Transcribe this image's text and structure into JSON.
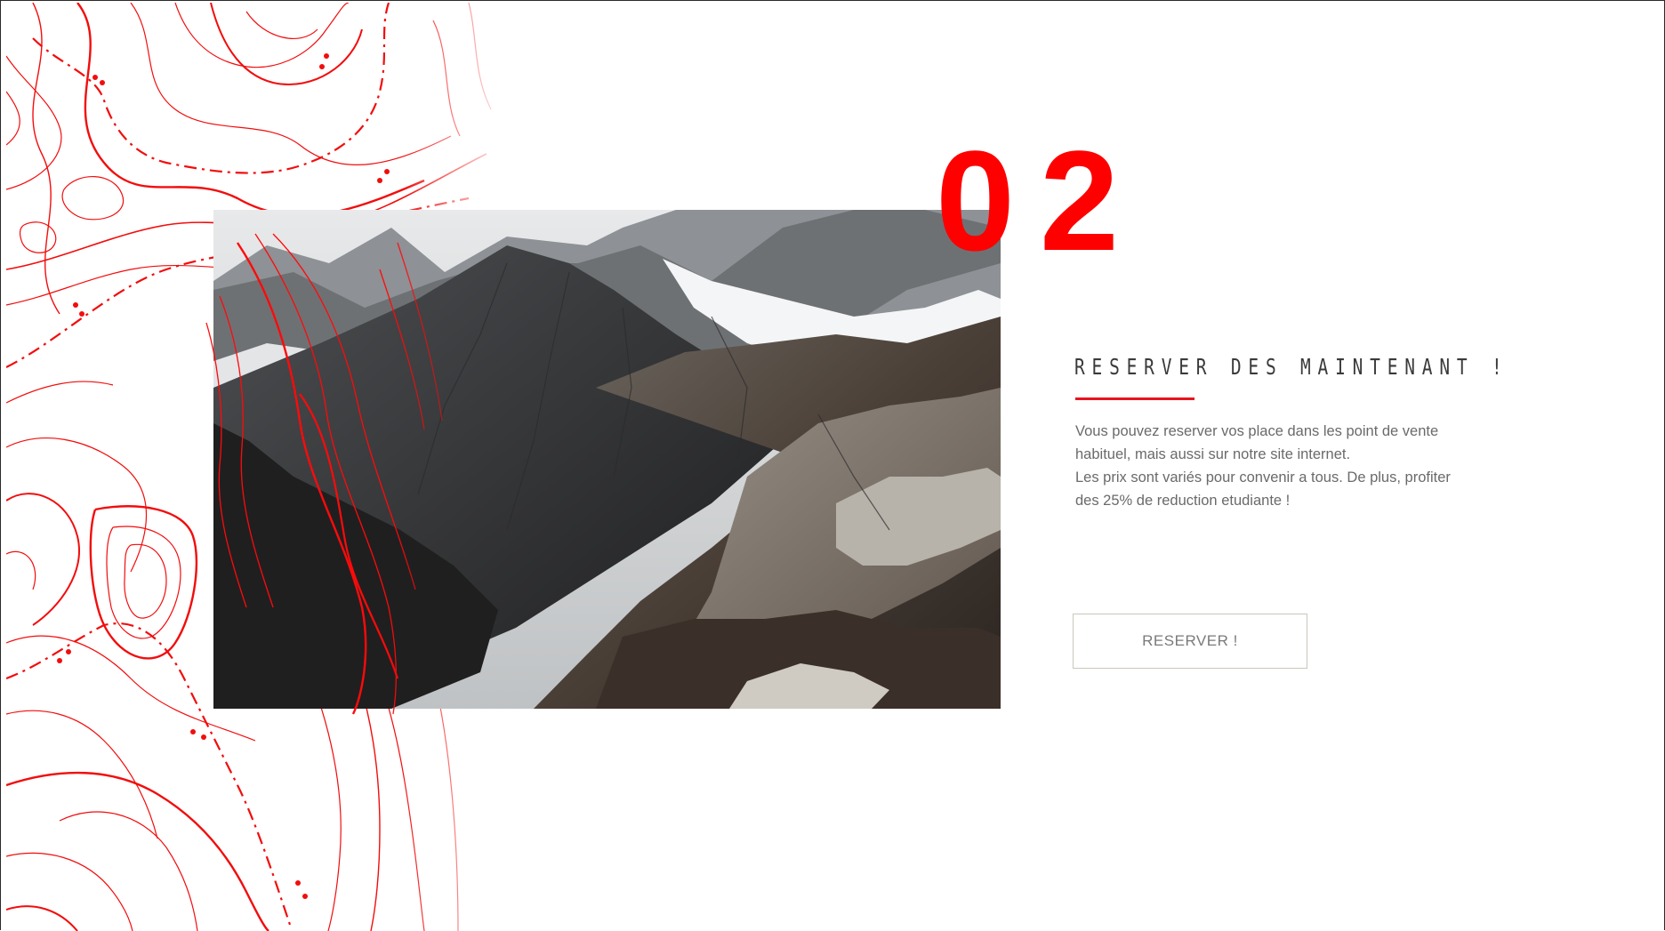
{
  "section_number": "02",
  "heading": "RESERVER DES MAINTENANT !",
  "body": {
    "line1": "Vous pouvez reserver vos place dans les point de vente habituel, mais aussi sur notre site internet.",
    "line2": "Les prix sont variés pour convenir a tous. De plus, profiter des 25% de reduction etudiante !"
  },
  "cta_label": "RESERVER !",
  "colors": {
    "accent": "#ff0000",
    "text": "#3a3a3a",
    "muted": "#6a6a6a"
  },
  "icons": {
    "background": "topographic-map-lines",
    "image": "mountain-photo"
  }
}
